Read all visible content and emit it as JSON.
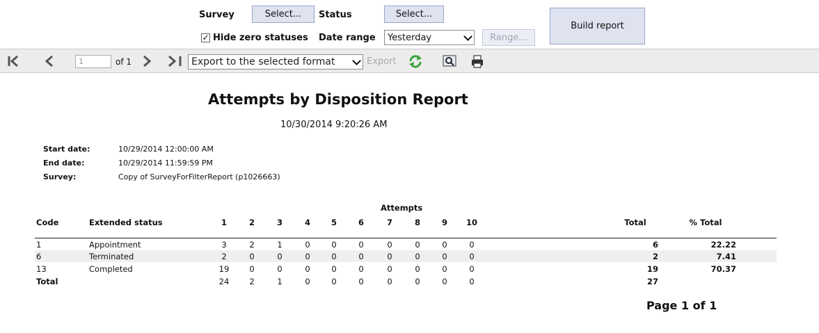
{
  "filters": {
    "survey_label": "Survey",
    "survey_button": "Select...",
    "status_label": "Status",
    "status_button": "Select...",
    "hide_zero_label": "Hide zero statuses",
    "hide_zero_checked": true,
    "date_range_label": "Date range",
    "date_range_value": "Yesterday",
    "range_button": "Range...",
    "build_button": "Build report"
  },
  "toolbar": {
    "page_value": "1",
    "of_label": "of 1",
    "export_format": "Export to the selected format",
    "export_button": "Export"
  },
  "report": {
    "title": "Attempts by Disposition Report",
    "generated": "10/30/2014 9:20:26 AM",
    "meta": [
      {
        "label": "Start date:",
        "value": "10/29/2014 12:00:00 AM"
      },
      {
        "label": "End date:",
        "value": "10/29/2014 11:59:59 PM"
      },
      {
        "label": "Survey:",
        "value": "Copy of SurveyForFilterReport (p1026663)"
      }
    ],
    "attempts_header": "Attempts",
    "columns": [
      "Code",
      "Extended status",
      "1",
      "2",
      "3",
      "4",
      "5",
      "6",
      "7",
      "8",
      "9",
      "10",
      "Total",
      "% Total"
    ],
    "rows": [
      [
        "1",
        "Appointment",
        "3",
        "2",
        "1",
        "0",
        "0",
        "0",
        "0",
        "0",
        "0",
        "0",
        "6",
        "22.22"
      ],
      [
        "6",
        "Terminated",
        "2",
        "0",
        "0",
        "0",
        "0",
        "0",
        "0",
        "0",
        "0",
        "0",
        "2",
        "7.41"
      ],
      [
        "13",
        "Completed",
        "19",
        "0",
        "0",
        "0",
        "0",
        "0",
        "0",
        "0",
        "0",
        "0",
        "19",
        "70.37"
      ]
    ],
    "totals": [
      "Total",
      "",
      "24",
      "2",
      "1",
      "0",
      "0",
      "0",
      "0",
      "0",
      "0",
      "0",
      "27",
      ""
    ],
    "page_footer": "Page 1 of 1"
  }
}
